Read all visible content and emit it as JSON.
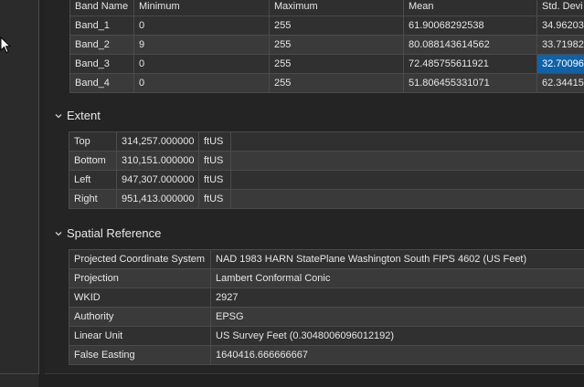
{
  "band_stats": {
    "headers": [
      "Band Name",
      "Minimum",
      "Maximum",
      "Mean",
      "Std. Devi"
    ],
    "rows": [
      [
        "Band_1",
        "0",
        "255",
        "61.90068292538",
        "34.96203"
      ],
      [
        "Band_2",
        "9",
        "255",
        "80.088143614562",
        "33.71982"
      ],
      [
        "Band_3",
        "0",
        "255",
        "72.485755611921",
        "32.70096"
      ],
      [
        "Band_4",
        "0",
        "255",
        "51.806455331071",
        "62.34415"
      ]
    ]
  },
  "extent": {
    "title": "Extent",
    "rows": [
      [
        "Top",
        "314,257.000000",
        "ftUS"
      ],
      [
        "Bottom",
        "310,151.000000",
        "ftUS"
      ],
      [
        "Left",
        "947,307.000000",
        "ftUS"
      ],
      [
        "Right",
        "951,413.000000",
        "ftUS"
      ]
    ]
  },
  "spatial_reference": {
    "title": "Spatial Reference",
    "rows": [
      [
        "Projected Coordinate System",
        "NAD 1983 HARN StatePlane Washington South FIPS 4602 (US Feet)"
      ],
      [
        "Projection",
        "Lambert Conformal Conic"
      ],
      [
        "WKID",
        "2927"
      ],
      [
        "Authority",
        "EPSG"
      ],
      [
        "Linear Unit",
        "US Survey Feet (0.3048006096012192)"
      ],
      [
        "False Easting",
        "1640416.666666667"
      ]
    ]
  },
  "colors": {
    "background": "#212121",
    "cell_odd": "#303030",
    "cell_even": "#3a3a3a",
    "border": "#4b4b4b",
    "selection": "#0f62a8",
    "text": "#e6e6e6"
  },
  "icons": {
    "cursor": "mouse-pointer-icon",
    "section_toggle": "chevron-down-icon"
  }
}
